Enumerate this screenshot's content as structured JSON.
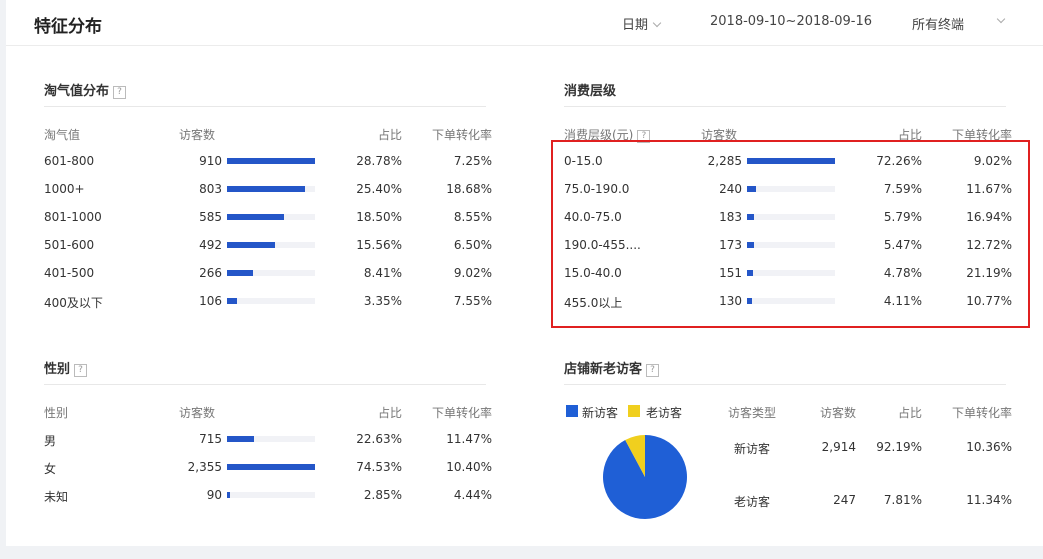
{
  "header": {
    "title": "特征分布",
    "date_label": "日期",
    "date_range": "2018-09-10~2018-09-16",
    "device_label": "所有终端"
  },
  "colors": {
    "bar": "#2456c8",
    "new_visitor": "#1f5fd6",
    "old_visitor": "#f0cf1e",
    "highlight": "#e02020"
  },
  "taoqi": {
    "title": "淘气值分布",
    "columns": [
      "淘气值",
      "访客数",
      "占比",
      "下单转化率"
    ],
    "rows": [
      {
        "label": "601-800",
        "visitors": "910",
        "share": "28.78%",
        "conv": "7.25%",
        "bar": 1.0
      },
      {
        "label": "1000+",
        "visitors": "803",
        "share": "25.40%",
        "conv": "18.68%",
        "bar": 0.882
      },
      {
        "label": "801-1000",
        "visitors": "585",
        "share": "18.50%",
        "conv": "8.55%",
        "bar": 0.643
      },
      {
        "label": "501-600",
        "visitors": "492",
        "share": "15.56%",
        "conv": "6.50%",
        "bar": 0.541
      },
      {
        "label": "401-500",
        "visitors": "266",
        "share": "8.41%",
        "conv": "9.02%",
        "bar": 0.292
      },
      {
        "label": "400及以下",
        "visitors": "106",
        "share": "3.35%",
        "conv": "7.55%",
        "bar": 0.116
      }
    ]
  },
  "consumption": {
    "title": "消费层级",
    "columns": [
      "消费层级(元)",
      "访客数",
      "占比",
      "下单转化率"
    ],
    "rows": [
      {
        "label": "0-15.0",
        "visitors": "2,285",
        "share": "72.26%",
        "conv": "9.02%",
        "bar": 1.0
      },
      {
        "label": "75.0-190.0",
        "visitors": "240",
        "share": "7.59%",
        "conv": "11.67%",
        "bar": 0.105
      },
      {
        "label": "40.0-75.0",
        "visitors": "183",
        "share": "5.79%",
        "conv": "16.94%",
        "bar": 0.08
      },
      {
        "label": "190.0-455....",
        "visitors": "173",
        "share": "5.47%",
        "conv": "12.72%",
        "bar": 0.076
      },
      {
        "label": "15.0-40.0",
        "visitors": "151",
        "share": "4.78%",
        "conv": "21.19%",
        "bar": 0.066
      },
      {
        "label": "455.0以上",
        "visitors": "130",
        "share": "4.11%",
        "conv": "10.77%",
        "bar": 0.057
      }
    ]
  },
  "gender": {
    "title": "性别",
    "columns": [
      "性别",
      "访客数",
      "占比",
      "下单转化率"
    ],
    "rows": [
      {
        "label": "男",
        "visitors": "715",
        "share": "22.63%",
        "conv": "11.47%",
        "bar": 0.304
      },
      {
        "label": "女",
        "visitors": "2,355",
        "share": "74.53%",
        "conv": "10.40%",
        "bar": 1.0
      },
      {
        "label": "未知",
        "visitors": "90",
        "share": "2.85%",
        "conv": "4.44%",
        "bar": 0.038
      }
    ]
  },
  "visitors": {
    "title": "店铺新老访客",
    "legend": [
      "新访客",
      "老访客"
    ],
    "columns": [
      "访客类型",
      "访客数",
      "占比",
      "下单转化率"
    ],
    "rows": [
      {
        "label": "新访客",
        "visitors": "2,914",
        "share": "92.19%",
        "conv": "10.36%"
      },
      {
        "label": "老访客",
        "visitors": "247",
        "share": "7.81%",
        "conv": "11.34%"
      }
    ],
    "pie_new_fraction": 0.9219
  }
}
